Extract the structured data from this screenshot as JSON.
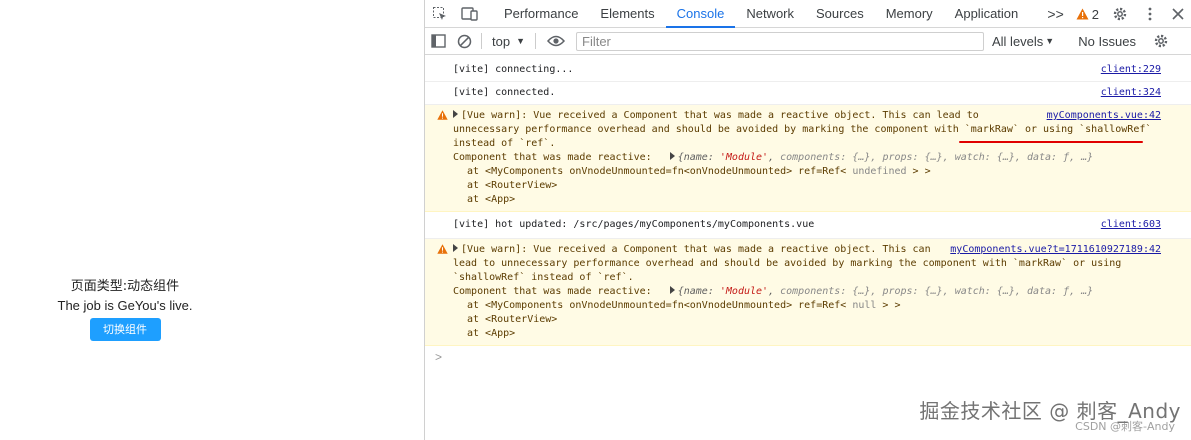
{
  "app": {
    "title": "页面类型:动态组件",
    "job_text": "The job is GeYou's live.",
    "switch_button": "切换组件"
  },
  "devtools": {
    "tabs": [
      "Performance",
      "Elements",
      "Console",
      "Network",
      "Sources",
      "Memory",
      "Application"
    ],
    "active_tab": "Console",
    "more_tabs": ">>",
    "warning_count": "2",
    "context": "top",
    "filter_placeholder": "Filter",
    "levels": "All levels",
    "issues": "No Issues"
  },
  "console": {
    "messages": [
      {
        "text": "[vite] connecting...",
        "source": "client:229"
      },
      {
        "text": "[vite] connected.",
        "source": "client:324"
      },
      {
        "line1": "[Vue warn]: Vue received a Component that was made a reactive object. This can lead to",
        "line2": "unnecessary performance overhead and should be avoided by marking the component with `markRaw` or using `shallowRef`",
        "line3": "instead of `ref`.",
        "component_label": "Component that was made reactive:",
        "obj_name_key": "name:",
        "obj_name_val": "'Module'",
        "obj_rest": "components: {…}, props: {…}, watch: {…}, data: ƒ, …}",
        "stack1": "at <MyComponents onVnodeUnmounted=fn<onVnodeUnmounted> ref=Ref<",
        "stack1_ref": " undefined ",
        "stack1_end": "> >",
        "stack2": "at <RouterView>",
        "stack3": "at <App>",
        "source": "myComponents.vue:42"
      },
      {
        "text": "[vite] hot updated: /src/pages/myComponents/myComponents.vue",
        "source": "client:603"
      },
      {
        "line1": "[Vue warn]: Vue received a Component that was made a reactive object. This can",
        "line2": "lead to unnecessary performance overhead and should be avoided by marking the component with `markRaw` or using",
        "line3": "`shallowRef` instead of `ref`.",
        "component_label": "Component that was made reactive:",
        "obj_name_key": "name:",
        "obj_name_val": "'Module'",
        "obj_rest": "components: {…}, props: {…}, watch: {…}, data: ƒ, …}",
        "stack1": "at <MyComponents onVnodeUnmounted=fn<onVnodeUnmounted> ref=Ref<",
        "stack1_ref": " null ",
        "stack1_end": "> >",
        "stack2": "at <RouterView>",
        "stack3": "at <App>",
        "source": "myComponents.vue?t=1711610927189:42"
      }
    ],
    "prompt": ">"
  },
  "watermark": {
    "main": "掘金技术社区 @ 刺客_Andy",
    "sub": "CSDN @刺客-Andy"
  },
  "colors": {
    "accent": "#1a73e8",
    "warning_bg": "#fffbe5",
    "button_bg": "#1e9fff",
    "annotation_underline": "#e00000"
  }
}
